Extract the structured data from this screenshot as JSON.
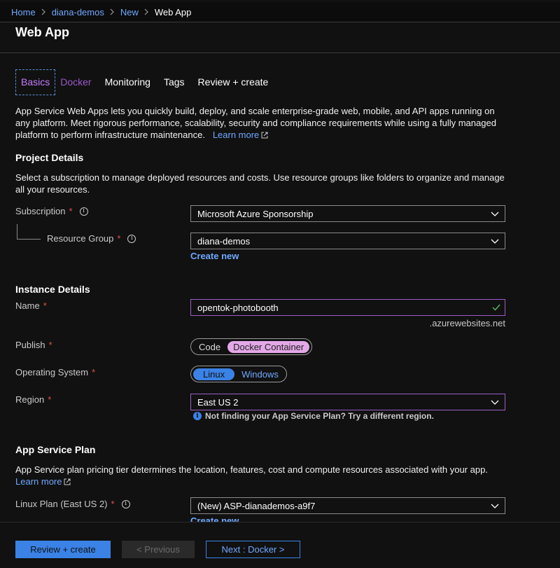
{
  "breadcrumb": {
    "items": [
      "Home",
      "diana-demos",
      "New"
    ],
    "current": "Web App"
  },
  "page_title": "Web App",
  "tabs": [
    {
      "label": "Basics",
      "state": "active"
    },
    {
      "label": "Docker",
      "state": "visited"
    },
    {
      "label": "Monitoring",
      "state": "normal"
    },
    {
      "label": "Tags",
      "state": "normal"
    },
    {
      "label": "Review + create",
      "state": "normal"
    }
  ],
  "intro": {
    "text": "App Service Web Apps lets you quickly build, deploy, and scale enterprise-grade web, mobile, and API apps running on any platform. Meet rigorous performance, scalability, security and compliance requirements while using a fully managed platform to perform infrastructure maintenance.",
    "link": "Learn more"
  },
  "project": {
    "heading": "Project Details",
    "description": "Select a subscription to manage deployed resources and costs. Use resource groups like folders to organize and manage all your resources.",
    "subscription_label": "Subscription",
    "subscription_value": "Microsoft Azure Sponsorship",
    "rg_label": "Resource Group",
    "rg_value": "diana-demos",
    "create_new": "Create new"
  },
  "instance": {
    "heading": "Instance Details",
    "name_label": "Name",
    "name_value": "opentok-photobooth",
    "name_suffix": ".azurewebsites.net",
    "publish_label": "Publish",
    "publish_options": [
      "Code",
      "Docker Container"
    ],
    "publish_selected": "Docker Container",
    "os_label": "Operating System",
    "os_options": [
      "Linux",
      "Windows"
    ],
    "os_selected": "Linux",
    "region_label": "Region",
    "region_value": "East US 2",
    "region_note": "Not finding your App Service Plan? Try a different region."
  },
  "plan": {
    "heading": "App Service Plan",
    "description": "App Service plan pricing tier determines the location, features, cost and compute resources associated with your app.",
    "learn_more": "Learn more",
    "linux_plan_label": "Linux Plan (East US 2)",
    "linux_plan_value": "(New) ASP-dianademos-a9f7",
    "create_new": "Create new"
  },
  "required_marker": "*",
  "footer": {
    "review_create": "Review + create",
    "previous": "< Previous",
    "next": "Next : Docker >"
  },
  "colors": {
    "background": "#111111",
    "accent_blue": "#3a82e6",
    "link_blue": "#6fa8ff",
    "active_tab_purple": "#c77cff",
    "required_red": "#e0524a",
    "valid_green": "#5cb85c",
    "publish_selected_pink": "#e4a8e8"
  }
}
